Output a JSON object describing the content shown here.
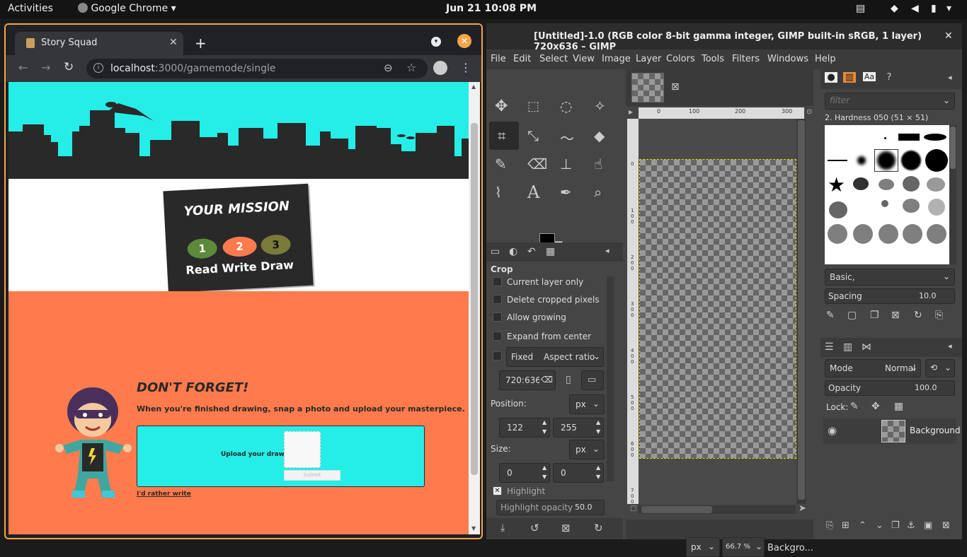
{
  "topbar": {
    "activities": "Activities",
    "app_name": "Google Chrome",
    "datetime": "Jun 21  10:08 PM"
  },
  "chrome": {
    "tab_title": "Story Squad",
    "url_host": "localhost",
    "url_path": ":3000/gamemode/single",
    "page": {
      "mission_title": "YOUR MISSION",
      "steps": [
        {
          "num": "1",
          "color": "#5b8a3a"
        },
        {
          "num": "2",
          "color": "#ff7b4d"
        },
        {
          "num": "3",
          "color": "#7a7a3a"
        }
      ],
      "steps_label": "Read Write Draw",
      "dont_forget": "DON'T FORGET!",
      "instruction": "When you're finished drawing, snap a photo and upload your masterpiece.",
      "upload_label": "Upload your drawing",
      "submit_label": "Submit",
      "rather_write": "I'd rather write",
      "colors": {
        "sky": "#25eee8",
        "skyline": "#292929",
        "orange": "#ff7b4d"
      }
    }
  },
  "gimp": {
    "title": "[Untitled]-1.0 (RGB color 8-bit gamma integer, GIMP built-in sRGB, 1 layer) 720x636 – GIMP",
    "menu": [
      "File",
      "Edit",
      "Select",
      "View",
      "Image",
      "Layer",
      "Colors",
      "Tools",
      "Filters",
      "Windows",
      "Help"
    ],
    "tool_options": {
      "heading": "Crop",
      "options": [
        "Current layer only",
        "Delete cropped pixels",
        "Allow growing",
        "Expand from center"
      ],
      "fixed_label": "Fixed",
      "fixed_value": "Aspect ratio",
      "ratio_value": "720:636",
      "position_label": "Position:",
      "position_unit": "px",
      "position_x": "122",
      "position_y": "255",
      "size_label": "Size:",
      "size_unit": "px",
      "size_w": "0",
      "size_h": "0",
      "highlight_label": "Highlight",
      "highlight_opacity_label": "Highlight opacity",
      "highlight_opacity_value": "50.0"
    },
    "ruler_top": [
      "0",
      "100",
      "200",
      "300"
    ],
    "ruler_left": [
      "0",
      "100",
      "200",
      "300",
      "400",
      "500",
      "600",
      "700"
    ],
    "status": {
      "unit": "px",
      "zoom": "66.7 %",
      "layer": "Backgro..."
    },
    "brushes": {
      "filter_placeholder": "filter",
      "selected_brush": "2. Hardness 050 (51 × 51)",
      "preset": "Basic,",
      "spacing_label": "Spacing",
      "spacing_value": "10.0"
    },
    "layers": {
      "mode_label": "Mode",
      "mode_value": "Normal",
      "opacity_label": "Opacity",
      "opacity_value": "100.0",
      "lock_label": "Lock:",
      "layer_name": "Background"
    }
  }
}
